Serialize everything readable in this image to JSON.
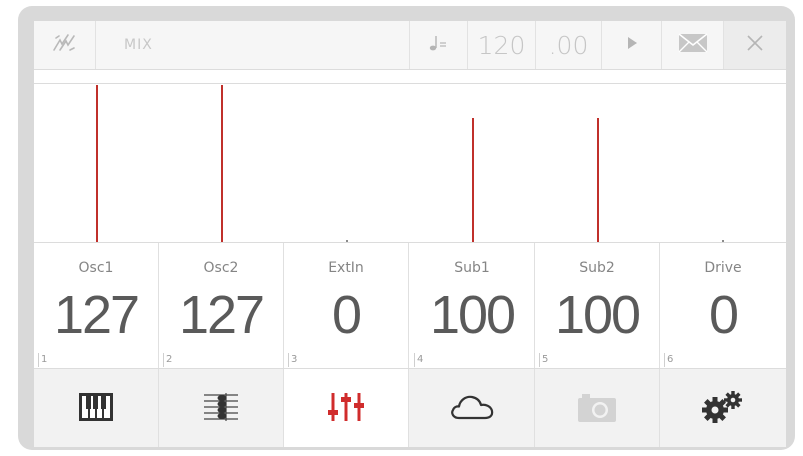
{
  "topbar": {
    "title": "MIX",
    "tempo_whole": "120",
    "tempo_fraction": ".00"
  },
  "meters": [
    {
      "channel": "Osc1",
      "level": 127
    },
    {
      "channel": "Osc2",
      "level": 127
    },
    {
      "channel": "ExtIn",
      "level": 0
    },
    {
      "channel": "Sub1",
      "level": 100
    },
    {
      "channel": "Sub2",
      "level": 100
    },
    {
      "channel": "Drive",
      "level": 0
    }
  ],
  "channels": [
    {
      "name": "Osc1",
      "value": "127",
      "index": "1"
    },
    {
      "name": "Osc2",
      "value": "127",
      "index": "2"
    },
    {
      "name": "ExtIn",
      "value": "0",
      "index": "3"
    },
    {
      "name": "Sub1",
      "value": "100",
      "index": "4"
    },
    {
      "name": "Sub2",
      "value": "100",
      "index": "5"
    },
    {
      "name": "Drive",
      "value": "0",
      "index": "6"
    }
  ],
  "nav": [
    {
      "icon": "piano-keys-icon",
      "active": false
    },
    {
      "icon": "score-notes-icon",
      "active": false
    },
    {
      "icon": "mixer-sliders-icon",
      "active": true
    },
    {
      "icon": "cloud-icon",
      "active": false
    },
    {
      "icon": "camera-icon",
      "active": false
    },
    {
      "icon": "gears-icon",
      "active": false
    }
  ],
  "colors": {
    "accent": "#c0302b",
    "bezel": "#d9d9d9",
    "value_text": "#5a5a5a",
    "icon_dark": "#333333"
  }
}
